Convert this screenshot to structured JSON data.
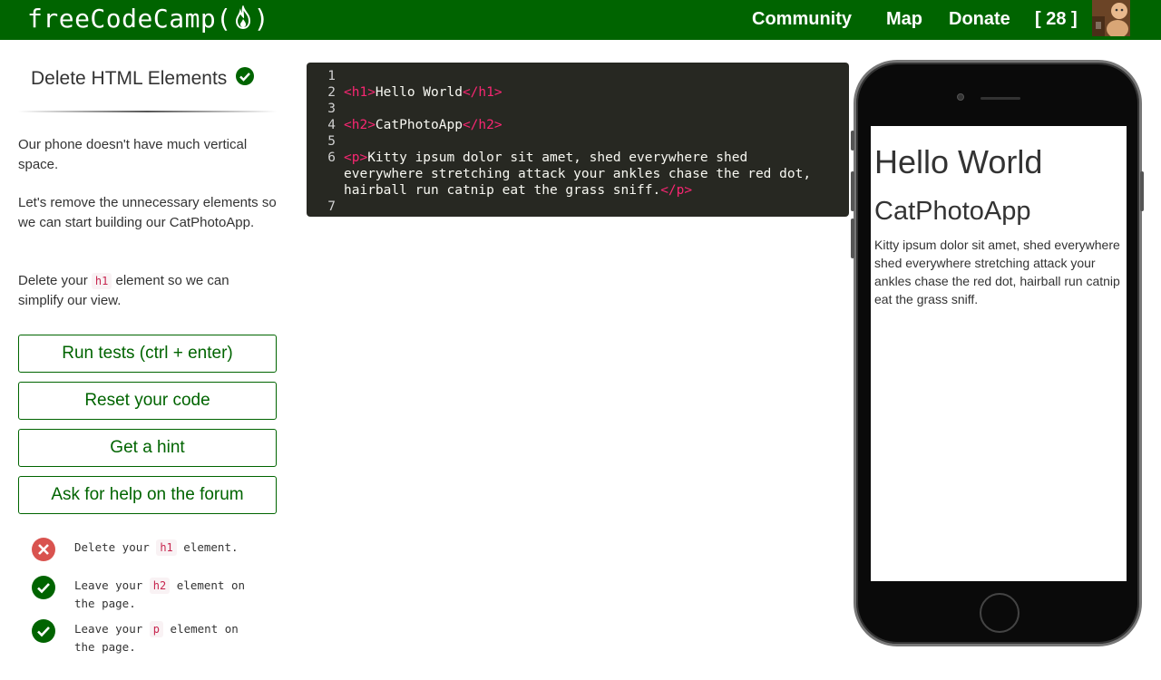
{
  "navbar": {
    "logo_text": "freeCodeCamp",
    "links": {
      "community": "Community",
      "map": "Map",
      "donate": "Donate"
    },
    "points": "[ 28 ]",
    "brand_color": "#006400"
  },
  "challenge": {
    "title": "Delete HTML Elements",
    "completed": true,
    "description": {
      "p1": "Our phone doesn't have much vertical space.",
      "p2": "Let's remove the unnecessary elements so we can start building our CatPhotoApp.",
      "p3_before": "Delete your ",
      "p3_code": "h1",
      "p3_after": " element so we can simplify our view."
    },
    "buttons": {
      "run": "Run tests (ctrl + enter)",
      "reset": "Reset your code",
      "hint": "Get a hint",
      "forum": "Ask for help on the forum"
    },
    "tests": [
      {
        "status": "fail",
        "before": "Delete your ",
        "code": "h1",
        "after": " element."
      },
      {
        "status": "pass",
        "before": "Leave your ",
        "code": "h2",
        "after": " element on the page."
      },
      {
        "status": "pass",
        "before": "Leave your ",
        "code": "p",
        "after": " element on the page."
      }
    ]
  },
  "editor": {
    "lines": [
      {
        "num": "1"
      },
      {
        "num": "2",
        "open": "<h1>",
        "text": "Hello World",
        "close": "</h1>"
      },
      {
        "num": "3"
      },
      {
        "num": "4",
        "open": "<h2>",
        "text": "CatPhotoApp",
        "close": "</h2>"
      },
      {
        "num": "5"
      },
      {
        "num": "6",
        "open": "<p>",
        "text": "Kitty ipsum dolor sit amet, shed everywhere shed"
      },
      {
        "num": "",
        "text": "everywhere stretching attack your ankles chase the red dot,"
      },
      {
        "num": "",
        "text": "hairball run catnip eat the grass sniff.",
        "close": "</p>"
      },
      {
        "num": "7"
      }
    ]
  },
  "preview": {
    "h1": "Hello World",
    "h2": "CatPhotoApp",
    "p": "Kitty ipsum dolor sit amet, shed everywhere shed everywhere stretching attack your ankles chase the red dot, hairball run catnip eat the grass sniff."
  }
}
